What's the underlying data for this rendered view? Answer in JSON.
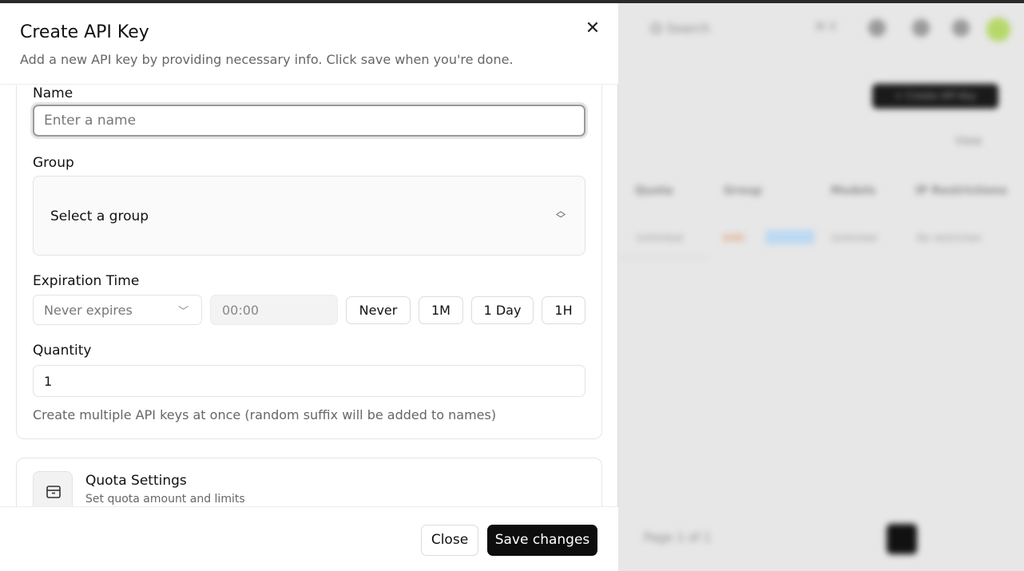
{
  "dialog": {
    "title": "Create API Key",
    "subtitle": "Add a new API key by providing necessary info. Click save when you're done."
  },
  "form": {
    "name_label": "Name",
    "name_placeholder": "Enter a name",
    "group_label": "Group",
    "group_value": "Select a group",
    "expiration_label": "Expiration Time",
    "expiration_value": "Never expires",
    "time_value": "00:00",
    "quick_options": [
      "Never",
      "1M",
      "1 Day",
      "1H"
    ],
    "quantity_label": "Quantity",
    "quantity_value": "1",
    "quantity_help": "Create multiple API keys at once (random suffix will be added to names)"
  },
  "quota": {
    "title": "Quota Settings",
    "subtitle": "Set quota amount and limits",
    "icon": "wallet-icon"
  },
  "footer": {
    "close_label": "Close",
    "save_label": "Save changes"
  },
  "background": {
    "search_label": "Search",
    "kbd": "⌘ K",
    "create_label": "+ Create API Key",
    "view_label": "View",
    "columns": [
      "Quota",
      "Group",
      "Models",
      "IP Restrictions"
    ],
    "row": [
      "Unlimited",
      "Unlimited",
      "No restriction"
    ],
    "group_tag": "auto",
    "pagination": "Page 1 of 1"
  },
  "colors": {
    "primary_button": "#0d0d0d",
    "accent_avatar": "#b6d86a"
  }
}
